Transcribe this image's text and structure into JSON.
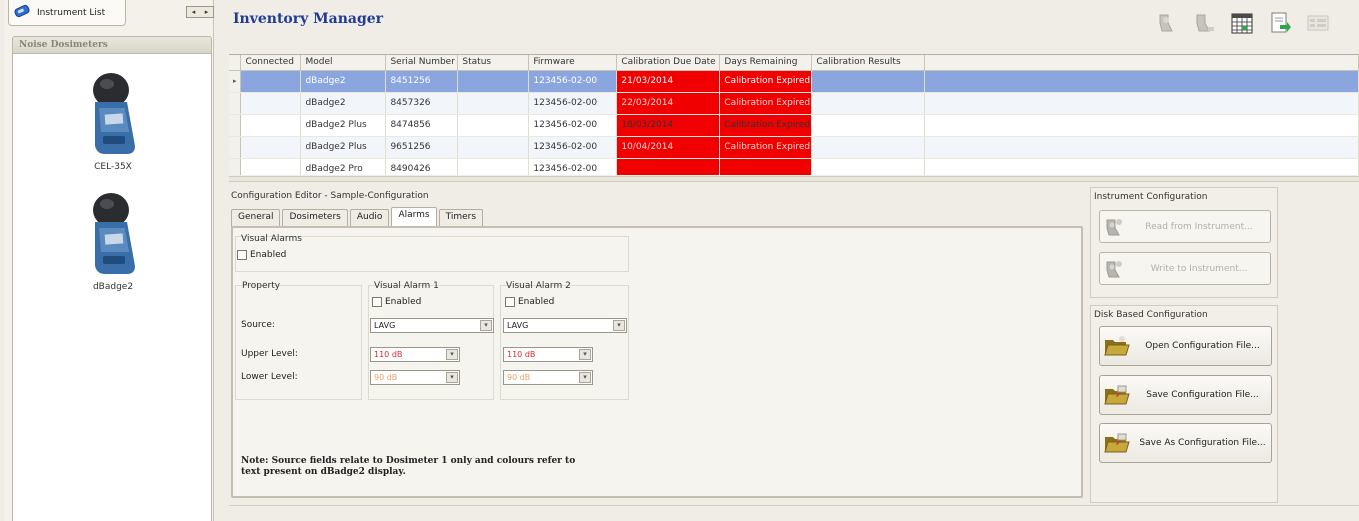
{
  "left": {
    "tab_label": "Instrument List",
    "nav": {
      "prev": "◂",
      "next": "▸"
    },
    "group_title": "Noise Dosimeters",
    "devices": [
      {
        "label": "CEL-35X",
        "icon": "dosimeter-icon"
      },
      {
        "label": "dBadge2",
        "icon": "dosimeter-icon"
      }
    ]
  },
  "app_title": "Inventory Manager",
  "toolbar": {
    "icons": [
      "instrument-connect-icon",
      "instrument-disconnect-icon",
      "calendar-icon",
      "export-icon",
      "grid-icon"
    ]
  },
  "grid": {
    "columns": [
      "Connected",
      "Model",
      "Serial Number",
      "Status",
      "Firmware",
      "Calibration Due Date",
      "Days Remaining",
      "Calibration Results"
    ],
    "rows": [
      {
        "connected": "",
        "model": "dBadge2",
        "serial": "8451256",
        "status": "",
        "firmware": "123456-02-00",
        "due": "21/03/2014",
        "days": "Calibration Expired",
        "results": ""
      },
      {
        "connected": "",
        "model": "dBadge2",
        "serial": "8457326",
        "status": "",
        "firmware": "123456-02-00",
        "due": "22/03/2014",
        "days": "Calibration Expired",
        "results": ""
      },
      {
        "connected": "",
        "model": "dBadge2 Plus",
        "serial": "8474856",
        "status": "",
        "firmware": "123456-02-00",
        "due": "18/03/2014",
        "days": "Calibration Expired",
        "results": ""
      },
      {
        "connected": "",
        "model": "dBadge2 Plus",
        "serial": "9651256",
        "status": "",
        "firmware": "123456-02-00",
        "due": "10/04/2014",
        "days": "Calibration Expired",
        "results": ""
      },
      {
        "connected": "",
        "model": "dBadge2 Pro",
        "serial": "8490426",
        "status": "",
        "firmware": "123456-02-00",
        "due": "",
        "days": "",
        "results": ""
      }
    ],
    "expired_color": "#f00000",
    "selected_color": "#8ba5df"
  },
  "config": {
    "title": "Configuration Editor - Sample-Configuration",
    "tabs": [
      "General",
      "Dosimeters",
      "Audio",
      "Alarms",
      "Timers"
    ],
    "active_tab": "Alarms",
    "visual_alarms": {
      "legend": "Visual Alarms",
      "enabled_label": "Enabled"
    },
    "property_legend": "Property",
    "alarm1": {
      "legend": "Visual Alarm 1",
      "enabled_label": "Enabled",
      "source": "LAVG",
      "upper": "110 dB",
      "lower": "90 dB"
    },
    "alarm2": {
      "legend": "Visual Alarm 2",
      "enabled_label": "Enabled",
      "source": "LAVG",
      "upper": "110 dB",
      "lower": "90 dB"
    },
    "labels": {
      "source": "Source:",
      "upper": "Upper Level:",
      "lower": "Lower Level:"
    },
    "upper_color": "#e0262f",
    "lower_color": "#e5a36b",
    "note_line1": "Note: Source fields relate to Dosimeter 1 only and colours refer to",
    "note_line2": "text present on dBadge2 display."
  },
  "instrument_config": {
    "title": "Instrument Configuration",
    "read_label": "Read from Instrument...",
    "write_label": "Write to Instrument..."
  },
  "disk_config": {
    "title": "Disk Based Configuration",
    "open_label": "Open Configuration File...",
    "save_label": "Save Configuration File...",
    "save_as_label": "Save As Configuration File..."
  }
}
